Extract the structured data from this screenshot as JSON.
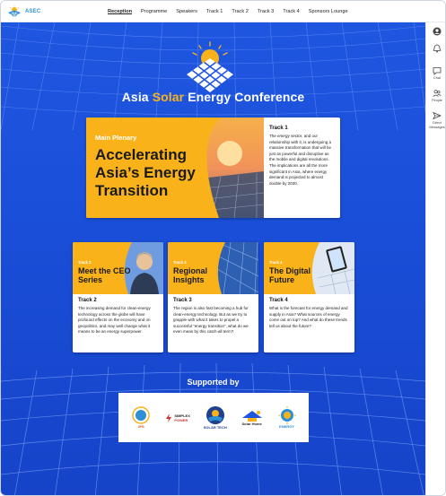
{
  "app": {
    "logo_text": "ASEC"
  },
  "nav": {
    "items": [
      {
        "label": "Reception",
        "active": true
      },
      {
        "label": "Programme"
      },
      {
        "label": "Speakers"
      },
      {
        "label": "Track 1"
      },
      {
        "label": "Track 2"
      },
      {
        "label": "Track 3"
      },
      {
        "label": "Track 4"
      },
      {
        "label": "Sponsors Lounge"
      }
    ]
  },
  "rail": {
    "items": [
      {
        "label": "",
        "icon": "user-circle-icon"
      },
      {
        "label": "",
        "icon": "bell-icon"
      },
      {
        "label": "Chat",
        "icon": "chat-icon"
      },
      {
        "label": "People",
        "icon": "people-icon"
      },
      {
        "label": "Direct Messages",
        "icon": "send-icon"
      }
    ]
  },
  "hero": {
    "title_pre": "Asia ",
    "title_accent": "Solar",
    "title_post": " Energy Conference",
    "accent_color": "#f9b219"
  },
  "plenary": {
    "kicker": "Main Plenary",
    "headline": "Accelerating Asia’s Energy Transition",
    "track_title": "Track 1",
    "italic_lead": "The energy sector",
    "body": ", and our relationship with it, is undergoing a massive transformation that will be just as powerful and disruptive as the mobile and digital revolutions. The implications are all the more significant in Asia, where energy demand is projected to almost double by 2030."
  },
  "tracks": [
    {
      "kicker": "Track 2",
      "headline": "Meet the CEO Series",
      "title": "Track 2",
      "body": "The increasing demand for clean-energy technology across the globe will have profound effects on the economy and on geopolitics, and may well change what it means to be an energy superpower."
    },
    {
      "kicker": "Track 3",
      "headline": "Regional Insights",
      "title": "Track 3",
      "body": "The region is also fast becoming a hub for clean-energy technology. But as we try to grapple with what it takes to propel a successful “energy transition”, what do we even mean by this catch-all term?"
    },
    {
      "kicker": "Track 4",
      "headline": "The Digital Future",
      "title": "Track 4",
      "body": "What is the forecast for energy demand and supply in Asia? What sources of energy come out on top? And what do these trends tell us about the future?"
    }
  ],
  "supported": {
    "heading": "Supported by",
    "sponsors": [
      {
        "name": "IPS"
      },
      {
        "name": "SIMPLEX",
        "sub": "POWER"
      },
      {
        "name": "SOLAR TECH"
      },
      {
        "name": "Solar Home"
      },
      {
        "name": "ENERGY"
      }
    ]
  },
  "colors": {
    "brand_blue": "#1f56e0",
    "accent_yellow": "#f9b219",
    "logo_blue": "#2d8fd5"
  }
}
